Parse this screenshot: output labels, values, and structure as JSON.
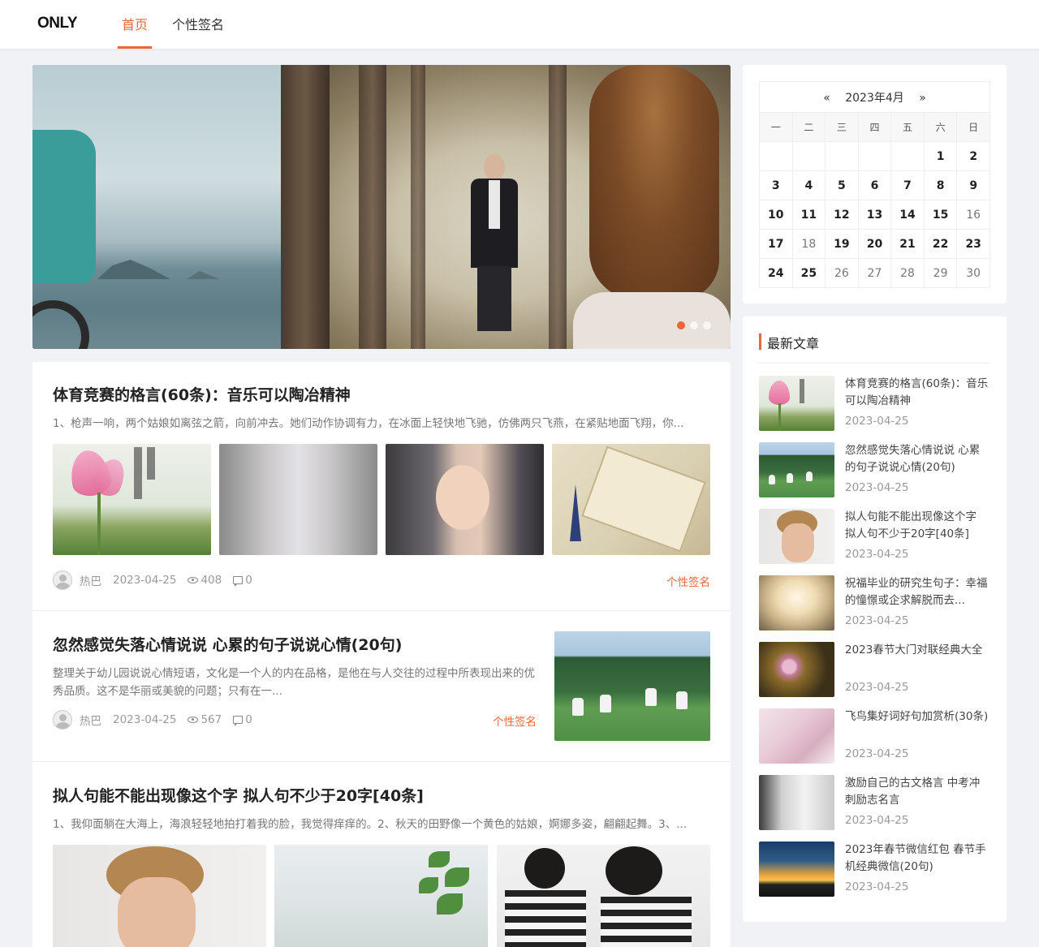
{
  "header": {
    "logo": "ONLY",
    "nav": [
      {
        "label": "首页",
        "active": true
      },
      {
        "label": "个性签名",
        "active": false
      }
    ]
  },
  "banner": {
    "slides_total": 3,
    "active_slide": 1
  },
  "articles": [
    {
      "title": "体育竞赛的格言(60条)：音乐可以陶冶精神",
      "excerpt": "1、枪声一响，两个姑娘如离弦之箭，向前冲去。她们动作协调有力，在冰面上轻快地飞驰，仿佛两只飞燕，在紧贴地面飞翔，你...",
      "author": "热巴",
      "date": "2023-04-25",
      "views": "408",
      "comments": "0",
      "category": "个性签名"
    },
    {
      "title": "忽然感觉失落心情说说 心累的句子说说心情(20句)",
      "excerpt": "整理关于幼儿园说说心情短语，文化是一个人的内在品格，是他在与人交往的过程中所表现出来的优秀品质。这不是华丽或美貌的问题；只有在一...",
      "author": "热巴",
      "date": "2023-04-25",
      "views": "567",
      "comments": "0",
      "category": "个性签名"
    },
    {
      "title": "拟人句能不能出现像这个字 拟人句不少于20字[40条]",
      "excerpt": "1、我仰面躺在大海上，海浪轻轻地拍打着我的脸，我觉得痒痒的。2、秋天的田野像一个黄色的姑娘，婀娜多姿，翩翩起舞。3、..."
    }
  ],
  "calendar": {
    "prev": "«",
    "next": "»",
    "month_label": "2023年4月",
    "weekdays": [
      "一",
      "二",
      "三",
      "四",
      "五",
      "六",
      "日"
    ],
    "weeks": [
      [
        {
          "d": "",
          "b": false
        },
        {
          "d": "",
          "b": false
        },
        {
          "d": "",
          "b": false
        },
        {
          "d": "",
          "b": false
        },
        {
          "d": "",
          "b": false
        },
        {
          "d": "1",
          "b": true
        },
        {
          "d": "2",
          "b": true
        }
      ],
      [
        {
          "d": "3",
          "b": true
        },
        {
          "d": "4",
          "b": true
        },
        {
          "d": "5",
          "b": true
        },
        {
          "d": "6",
          "b": true
        },
        {
          "d": "7",
          "b": true
        },
        {
          "d": "8",
          "b": true
        },
        {
          "d": "9",
          "b": true
        }
      ],
      [
        {
          "d": "10",
          "b": true
        },
        {
          "d": "11",
          "b": true
        },
        {
          "d": "12",
          "b": true
        },
        {
          "d": "13",
          "b": true
        },
        {
          "d": "14",
          "b": true
        },
        {
          "d": "15",
          "b": true
        },
        {
          "d": "16",
          "b": false
        }
      ],
      [
        {
          "d": "17",
          "b": true
        },
        {
          "d": "18",
          "b": false
        },
        {
          "d": "19",
          "b": true
        },
        {
          "d": "20",
          "b": true
        },
        {
          "d": "21",
          "b": true
        },
        {
          "d": "22",
          "b": true
        },
        {
          "d": "23",
          "b": true
        }
      ],
      [
        {
          "d": "24",
          "b": true
        },
        {
          "d": "25",
          "b": true
        },
        {
          "d": "26",
          "b": false
        },
        {
          "d": "27",
          "b": false
        },
        {
          "d": "28",
          "b": false
        },
        {
          "d": "29",
          "b": false
        },
        {
          "d": "30",
          "b": false
        }
      ]
    ]
  },
  "latest": {
    "heading": "最新文章",
    "items": [
      {
        "title": "体育竞赛的格言(60条)：音乐可以陶冶精神",
        "date": "2023-04-25"
      },
      {
        "title": "忽然感觉失落心情说说 心累的句子说说心情(20句)",
        "date": "2023-04-25"
      },
      {
        "title": "拟人句能不能出现像这个字 拟人句不少于20字[40条]",
        "date": "2023-04-25"
      },
      {
        "title": "祝福毕业的研究生句子：幸福的憧憬或企求解脱而去...",
        "date": "2023-04-25"
      },
      {
        "title": "2023春节大门对联经典大全",
        "date": "2023-04-25"
      },
      {
        "title": "飞鸟集好词好句加赏析(30条)",
        "date": "2023-04-25"
      },
      {
        "title": "激励自己的古文格言 中考冲刺励志名言",
        "date": "2023-04-25"
      },
      {
        "title": "2023年春节微信红包 春节手机经典微信(20句)",
        "date": "2023-04-25"
      }
    ]
  },
  "colors": {
    "accent": "#e9683a",
    "background": "#f1f2f6"
  }
}
